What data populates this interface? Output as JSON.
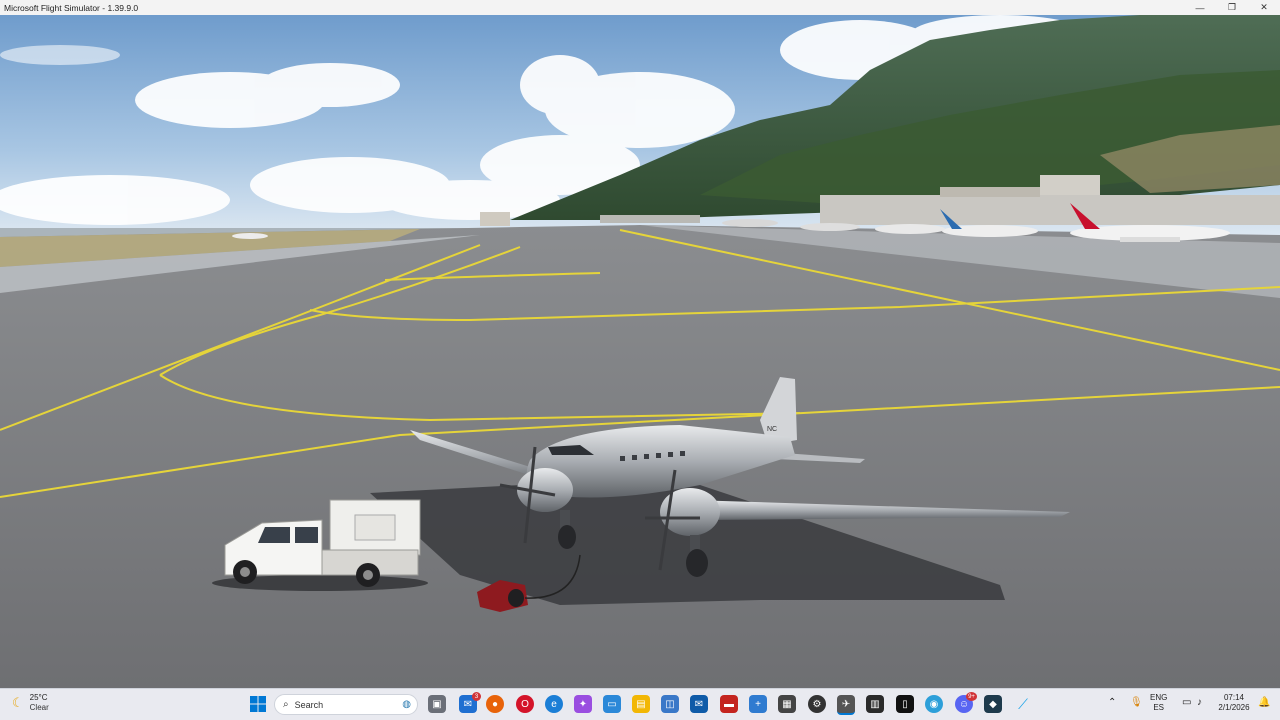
{
  "window": {
    "title": "Microsoft Flight Simulator - 1.39.9.0",
    "minimize_glyph": "—",
    "maximize_glyph": "❐",
    "close_glyph": "✕"
  },
  "scene": {
    "aircraft_registration": "NC"
  },
  "taskbar": {
    "weather_temp": "25°C",
    "weather_condition": "Clear",
    "search_label": "Search",
    "mail_badge": "3",
    "discord_badge": "9+",
    "language": "ENG",
    "keyboard_layout": "ES",
    "time": "07:14",
    "date": "2/1/2026"
  }
}
